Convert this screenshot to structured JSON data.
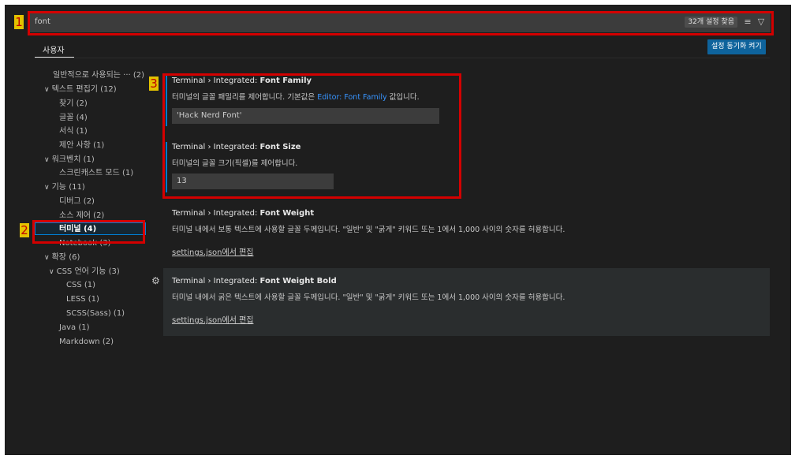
{
  "search": {
    "value": "font",
    "result_count": "32개 설정 찾음",
    "clear_icon": "clear-filter-icon",
    "filter_icon": "filter-icon"
  },
  "tabs": {
    "user": "사용자"
  },
  "sync_button": "설정 동기화 켜기",
  "tree": [
    {
      "label": "일반적으로 사용되는 ···",
      "count": "(2)"
    },
    {
      "label": "텍스트 편집기",
      "count": "(12)",
      "chevron": "∨"
    },
    {
      "label": "찾기",
      "count": "(2)"
    },
    {
      "label": "글꼴",
      "count": "(4)"
    },
    {
      "label": "서식",
      "count": "(1)"
    },
    {
      "label": "제안 사항",
      "count": "(1)"
    },
    {
      "label": "워크벤치",
      "count": "(1)",
      "chevron": "∨"
    },
    {
      "label": "스크린캐스트 모드",
      "count": "(1)"
    },
    {
      "label": "기능",
      "count": "(11)",
      "chevron": "∨"
    },
    {
      "label": "디버그",
      "count": "(2)"
    },
    {
      "label": "소스 제어",
      "count": "(2)"
    },
    {
      "label": "터미널",
      "count": "(4)"
    },
    {
      "label": "Notebook",
      "count": "(3)"
    },
    {
      "label": "확장",
      "count": "(6)",
      "chevron": "∨"
    },
    {
      "label": "CSS 언어 기능",
      "count": "(3)",
      "chevron": "∨"
    },
    {
      "label": "CSS",
      "count": "(1)"
    },
    {
      "label": "LESS",
      "count": "(1)"
    },
    {
      "label": "SCSS(Sass)",
      "count": "(1)"
    },
    {
      "label": "Java",
      "count": "(1)"
    },
    {
      "label": "Markdown",
      "count": "(2)"
    }
  ],
  "settings": [
    {
      "category": "Terminal › Integrated: ",
      "name": "Font Family",
      "desc_before": "터미널의 글꼴 패밀리를 제어합니다. 기본값은 ",
      "desc_link": "Editor: Font Family",
      "desc_after": " 값입니다.",
      "value": "'Hack Nerd Font'"
    },
    {
      "category": "Terminal › Integrated: ",
      "name": "Font Size",
      "desc": "터미널의 글꼴 크기(픽셀)를 제어합니다.",
      "value": "13"
    },
    {
      "category": "Terminal › Integrated: ",
      "name": "Font Weight",
      "desc": "터미널 내에서 보통 텍스트에 사용할 글꼴 두께입니다. \"일반\" 및 \"굵게\" 키워드 또는 1에서 1,000 사이의 숫자를 허용합니다.",
      "edit_link": "settings.json에서 편집"
    },
    {
      "category": "Terminal › Integrated: ",
      "name": "Font Weight Bold",
      "desc": "터미널 내에서 굵은 텍스트에 사용할 글꼴 두께입니다. \"일반\" 및 \"굵게\" 키워드 또는 1에서 1,000 사이의 숫자를 허용합니다.",
      "edit_link": "settings.json에서 편집"
    }
  ],
  "annotations": [
    "1",
    "2",
    "3"
  ],
  "colors": {
    "annotation_border": "#d40000",
    "annotation_badge": "#e3c200",
    "accent": "#007acc",
    "button": "#0e639c"
  }
}
